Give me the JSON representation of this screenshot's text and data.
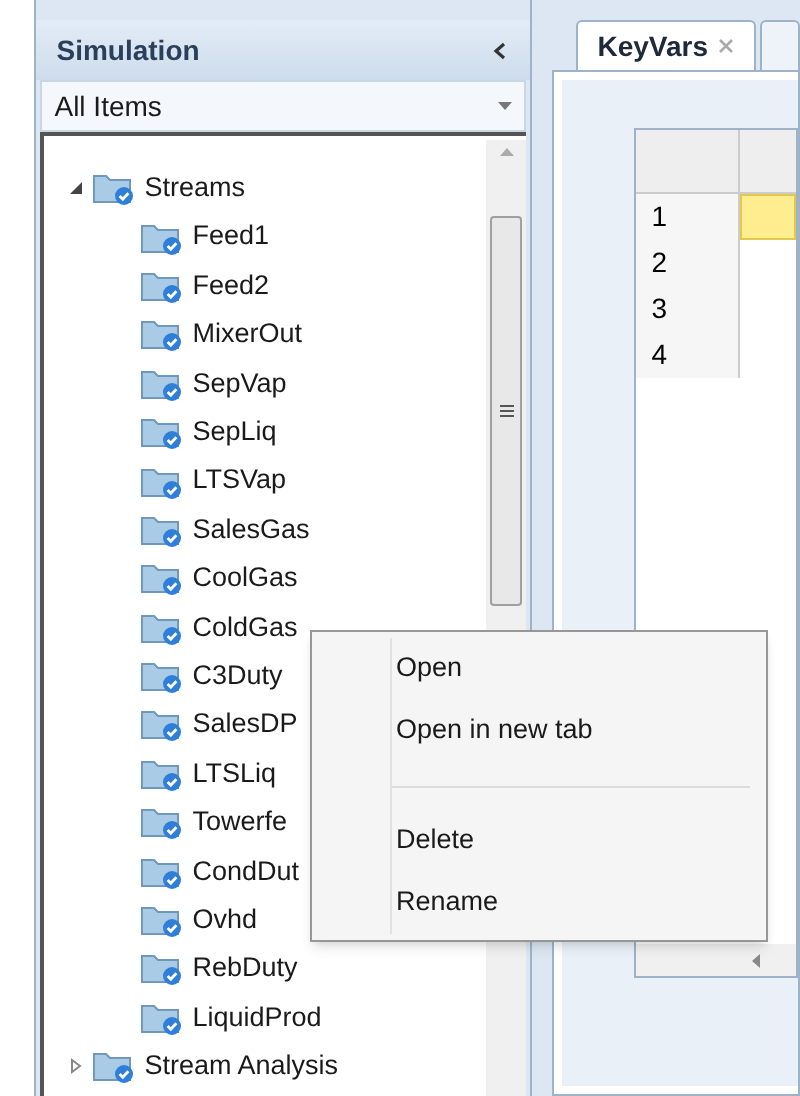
{
  "panel": {
    "title": "Simulation",
    "filter": "All Items"
  },
  "tree": [
    {
      "label": "Streams",
      "expanded": true,
      "children": [
        {
          "label": "Feed1"
        },
        {
          "label": "Feed2"
        },
        {
          "label": "MixerOut"
        },
        {
          "label": "SepVap"
        },
        {
          "label": "SepLiq"
        },
        {
          "label": "LTSVap"
        },
        {
          "label": "SalesGas"
        },
        {
          "label": "CoolGas"
        },
        {
          "label": "ColdGas"
        },
        {
          "label": "C3Duty"
        },
        {
          "label": "SalesDP"
        },
        {
          "label": "LTSLiq"
        },
        {
          "label": "Towerfe"
        },
        {
          "label": "CondDut"
        },
        {
          "label": "Ovhd"
        },
        {
          "label": "RebDuty"
        },
        {
          "label": "LiquidProd"
        }
      ]
    },
    {
      "label": "Stream Analysis",
      "expanded": false
    }
  ],
  "tabs": [
    {
      "label": "KeyVars",
      "selected": true
    }
  ],
  "grid": {
    "rows": [
      {
        "label": "1",
        "selected": true
      },
      {
        "label": "2",
        "selected": false
      },
      {
        "label": "3",
        "selected": false
      },
      {
        "label": "4",
        "selected": false
      }
    ]
  },
  "context_menu": [
    {
      "kind": "item",
      "label": "Open"
    },
    {
      "kind": "item",
      "label": "Open in new tab"
    },
    {
      "kind": "separator"
    },
    {
      "kind": "item",
      "label": "Delete"
    },
    {
      "kind": "item",
      "label": "Rename"
    }
  ]
}
